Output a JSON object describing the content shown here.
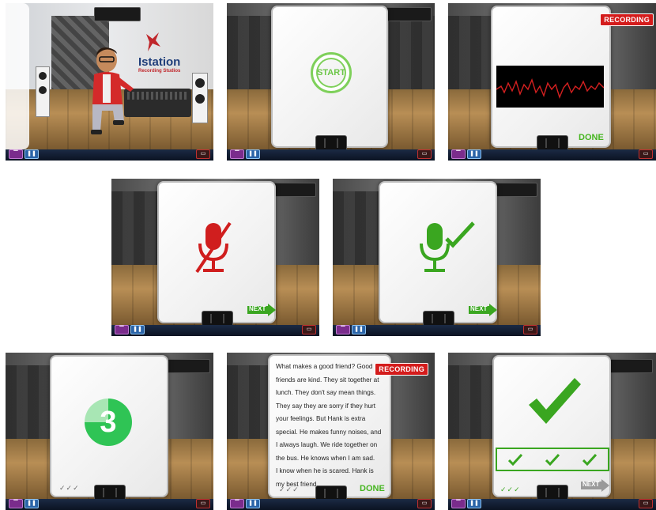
{
  "panels": {
    "studio": {
      "logo_main": "Istation",
      "logo_sub": "Recording Studios"
    },
    "start": {
      "button_label": "START"
    },
    "recording": {
      "badge": "RECORDING",
      "done_label": "DONE"
    },
    "mic_off": {
      "next_label": "NEXT"
    },
    "mic_ok": {
      "next_label": "NEXT"
    },
    "countdown": {
      "number": "3",
      "progress_checks": "✓✓✓"
    },
    "reading": {
      "badge": "RECORDING",
      "done_label": "DONE",
      "progress_checks": "✓✓✓",
      "story_lines": [
        "What makes a good friend? Good",
        "friends are kind. They sit together at",
        "lunch. They don't say mean things.",
        "They say they are sorry if they hurt",
        "your feelings. But Hank is extra",
        "special. He makes funny noises, and",
        "I always laugh. We ride together on",
        "the bus. He knows when I am sad.",
        "I know when he is scared. Hank is",
        "my best friend."
      ]
    },
    "complete": {
      "next_label": "NEXT",
      "progress_checks": "✓✓✓"
    }
  },
  "colors": {
    "green": "#3fbf2a",
    "red": "#c41a1a",
    "recording": "#d41c1c"
  },
  "icons": [
    "microphone-muted-icon",
    "microphone-icon",
    "checkmark-icon",
    "next-arrow-icon",
    "pause-icon",
    "menu-icon",
    "exit-icon"
  ]
}
